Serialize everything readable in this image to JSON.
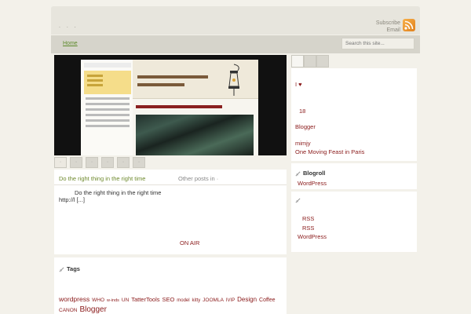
{
  "header": {
    "site_dots": ". .   .",
    "subscribe_label": "Subscribe",
    "email_label": "Email",
    "rss_icon": "rss-feed-icon"
  },
  "nav": {
    "home_label": "Home",
    "search_placeholder": "Search this site..."
  },
  "feature": {
    "tabs": [
      "·",
      "·",
      "·",
      "·",
      "·",
      "·"
    ]
  },
  "post": {
    "title": "Do the right thing in the right time",
    "other_posts": "Other posts in  ·",
    "excerpt_line1": "Do the right thing in the right time",
    "excerpt_line2": "http://l [...]",
    "on_air": "ON AIR"
  },
  "tags": {
    "title": "Tags",
    "items": [
      {
        "label": "wordpress",
        "size": 8.5
      },
      {
        "label": "WHO",
        "size": 6.5
      },
      {
        "label": "w-inds",
        "size": 5.5
      },
      {
        "label": "UN",
        "size": 6.5
      },
      {
        "label": "TatterTools",
        "size": 7.5
      },
      {
        "label": "SEO",
        "size": 7.5
      },
      {
        "label": "model",
        "size": 6
      },
      {
        "label": "kitty",
        "size": 6
      },
      {
        "label": "JOOMLA",
        "size": 6.5
      },
      {
        "label": "IVIP",
        "size": 6
      },
      {
        "label": "Design",
        "size": 8
      },
      {
        "label": "Coffee",
        "size": 7
      },
      {
        "label": "CANON",
        "size": 6.5
      },
      {
        "label": "Blogger",
        "size": 10
      }
    ]
  },
  "sidebar": {
    "box1": {
      "heart_text": "I ♥",
      "count": "18",
      "blogger": "Blogger",
      "mimjy": "mimjy",
      "moving_feast": "One Moving Feast in Paris"
    },
    "blogroll": {
      "title": "Blogroll",
      "link": "WordPress"
    },
    "meta": {
      "rss1": "RSS",
      "rss2": "RSS",
      "wordpress": "WordPress"
    }
  },
  "colors": {
    "link": "#8a1a1a",
    "nav_link": "#5d8a2b",
    "post_title": "#6f8a2e"
  }
}
